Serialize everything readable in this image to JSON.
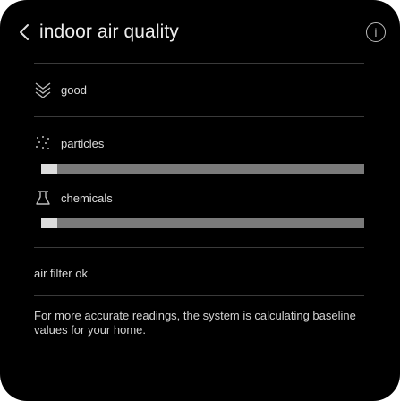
{
  "header": {
    "title": "indoor air quality",
    "info_glyph": "i"
  },
  "overall": {
    "label": "good",
    "icon": "air-flow-icon"
  },
  "metrics": [
    {
      "label": "particles",
      "icon": "particles-icon",
      "level": 0.05
    },
    {
      "label": "chemicals",
      "icon": "chemicals-icon",
      "level": 0.05
    }
  ],
  "filter": {
    "label": "air filter ok"
  },
  "description": "For more accurate readings, the system is calculating baseline values for your home.",
  "colors": {
    "background": "#000000",
    "bar_track": "#7a7a7a",
    "bar_fill": "#dcdcdc",
    "text": "#dcdcdc"
  }
}
